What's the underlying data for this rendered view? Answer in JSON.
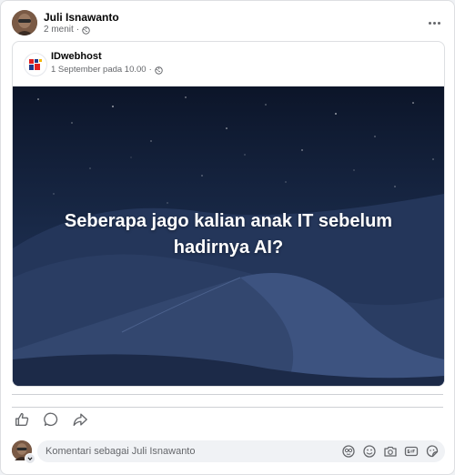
{
  "post": {
    "author": {
      "name": "Juli Isnawanto",
      "time": "2 menit",
      "separator": "·",
      "privacy_icon": "globe-icon"
    },
    "more_icon": "more-horizontal-icon"
  },
  "shared_post": {
    "page_name": "IDwebhost",
    "date": "1 September pada 10.00",
    "separator": "·",
    "privacy_icon": "globe-icon",
    "image_text": "Seberapa jago kalian anak IT sebelum hadirnya AI?"
  },
  "actions": [
    {
      "name": "like",
      "icon": "thumbs-up-icon"
    },
    {
      "name": "comment",
      "icon": "comment-bubble-icon"
    },
    {
      "name": "share",
      "icon": "share-arrow-icon"
    }
  ],
  "comment_box": {
    "placeholder": "Komentari sebagai Juli Isnawanto",
    "icons": [
      "avatar-sticker-icon",
      "emoji-icon",
      "camera-icon",
      "gif-icon",
      "sticker-icon"
    ]
  },
  "colors": {
    "primary_text": "#050505",
    "secondary_text": "#65676b",
    "border": "#dddfe2",
    "hero_bg": "#182846"
  }
}
